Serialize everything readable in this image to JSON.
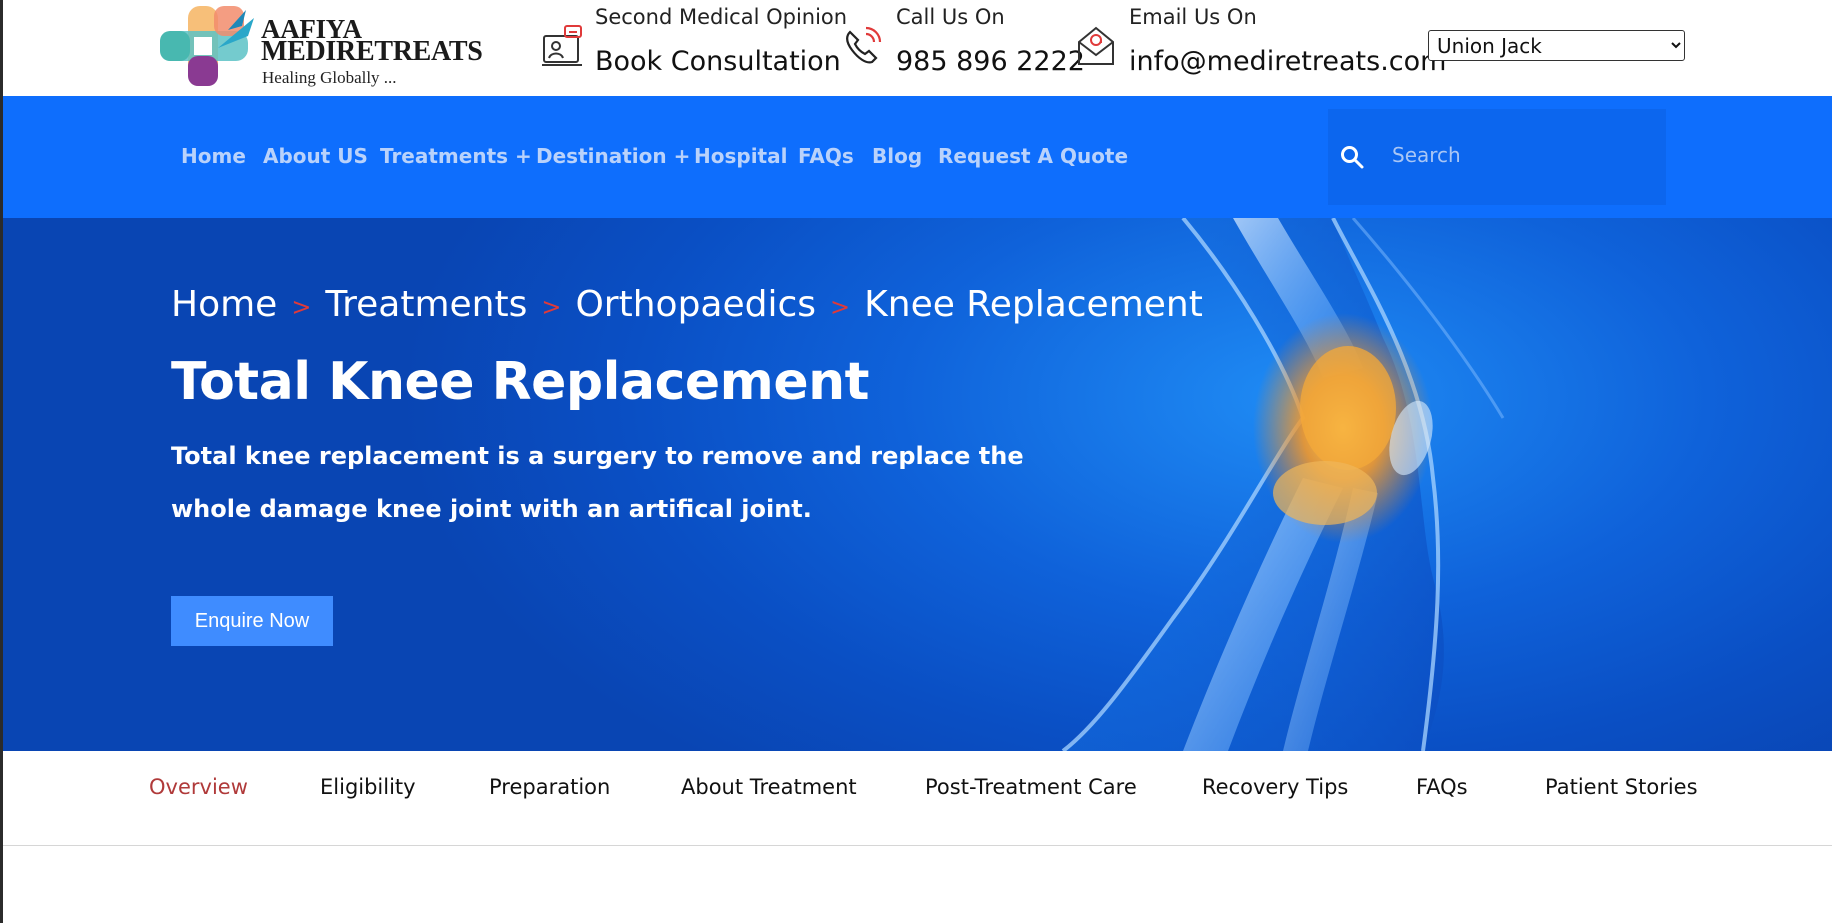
{
  "brand": {
    "name_line1": "AAFIYA",
    "name_line2": "MEDIRETREATS",
    "tagline": "Healing Globally ..."
  },
  "contacts": [
    {
      "icon": "consultation-icon",
      "label": "Second Medical Opinion",
      "value": "Book Consultation"
    },
    {
      "icon": "phone-icon",
      "label": "Call Us On",
      "value": "985 896 2222"
    },
    {
      "icon": "email-icon",
      "label": "Email Us On",
      "value": "info@mediretreats.com"
    }
  ],
  "language": {
    "selected": "Union Jack"
  },
  "nav": {
    "items": [
      "Home",
      "About US",
      "Treatments +",
      "Destination +",
      "Hospital",
      "FAQs",
      "Blog",
      "Request A Quote"
    ],
    "search_placeholder": "Search"
  },
  "hero": {
    "breadcrumb": [
      "Home",
      "Treatments",
      "Orthopaedics",
      "Knee Replacement"
    ],
    "separator": ">",
    "title": "Total Knee Replacement",
    "description": "Total knee replacement is a surgery to remove and replace the whole damage knee joint with an artifical joint.",
    "cta": "Enquire Now"
  },
  "tabs": {
    "items": [
      "Overview",
      "Eligibility",
      "Preparation",
      "About Treatment",
      "Post-Treatment Care",
      "Recovery Tips",
      "FAQs",
      "Patient Stories"
    ],
    "active": "Overview"
  },
  "colors": {
    "nav_bg": "#0e6efd",
    "nav_text": "#b9d2fb",
    "cta_bg": "#3f8cff",
    "active_tab": "#b03a3a",
    "breadcrumb_separator": "#e03a3a"
  }
}
